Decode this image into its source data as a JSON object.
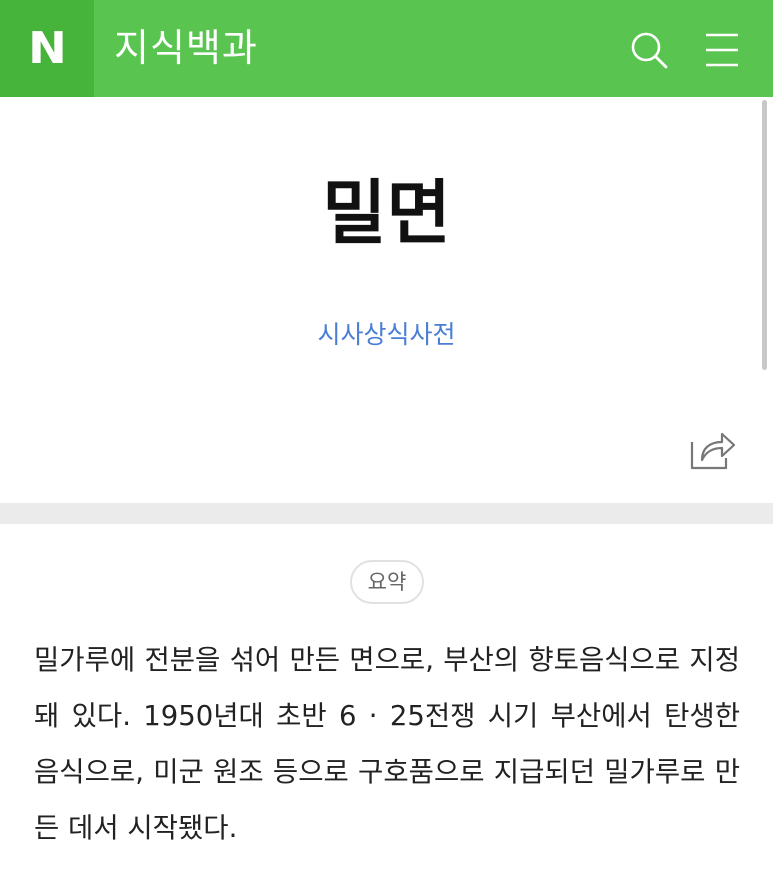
{
  "header": {
    "logo_letter": "N",
    "title": "지식백과"
  },
  "icons": {
    "search": "search-icon",
    "menu": "menu-icon",
    "share": "share-icon"
  },
  "colors": {
    "brand_green": "#5ac451",
    "logo_green": "#46b33b",
    "link_blue": "#4a7ed6"
  },
  "entry": {
    "title": "밀면",
    "source": "시사상식사전"
  },
  "summary": {
    "label": "요약",
    "text": "밀가루에 전분을 섞어 만든 면으로, 부산의 향토음식으로 지정돼 있다. 1950년대 초반 6 · 25전쟁 시기 부산에서 탄생한 음식으로, 미군 원조 등으로 구호품으로 지급되던 밀가루로 만든 데서 시작됐다."
  }
}
